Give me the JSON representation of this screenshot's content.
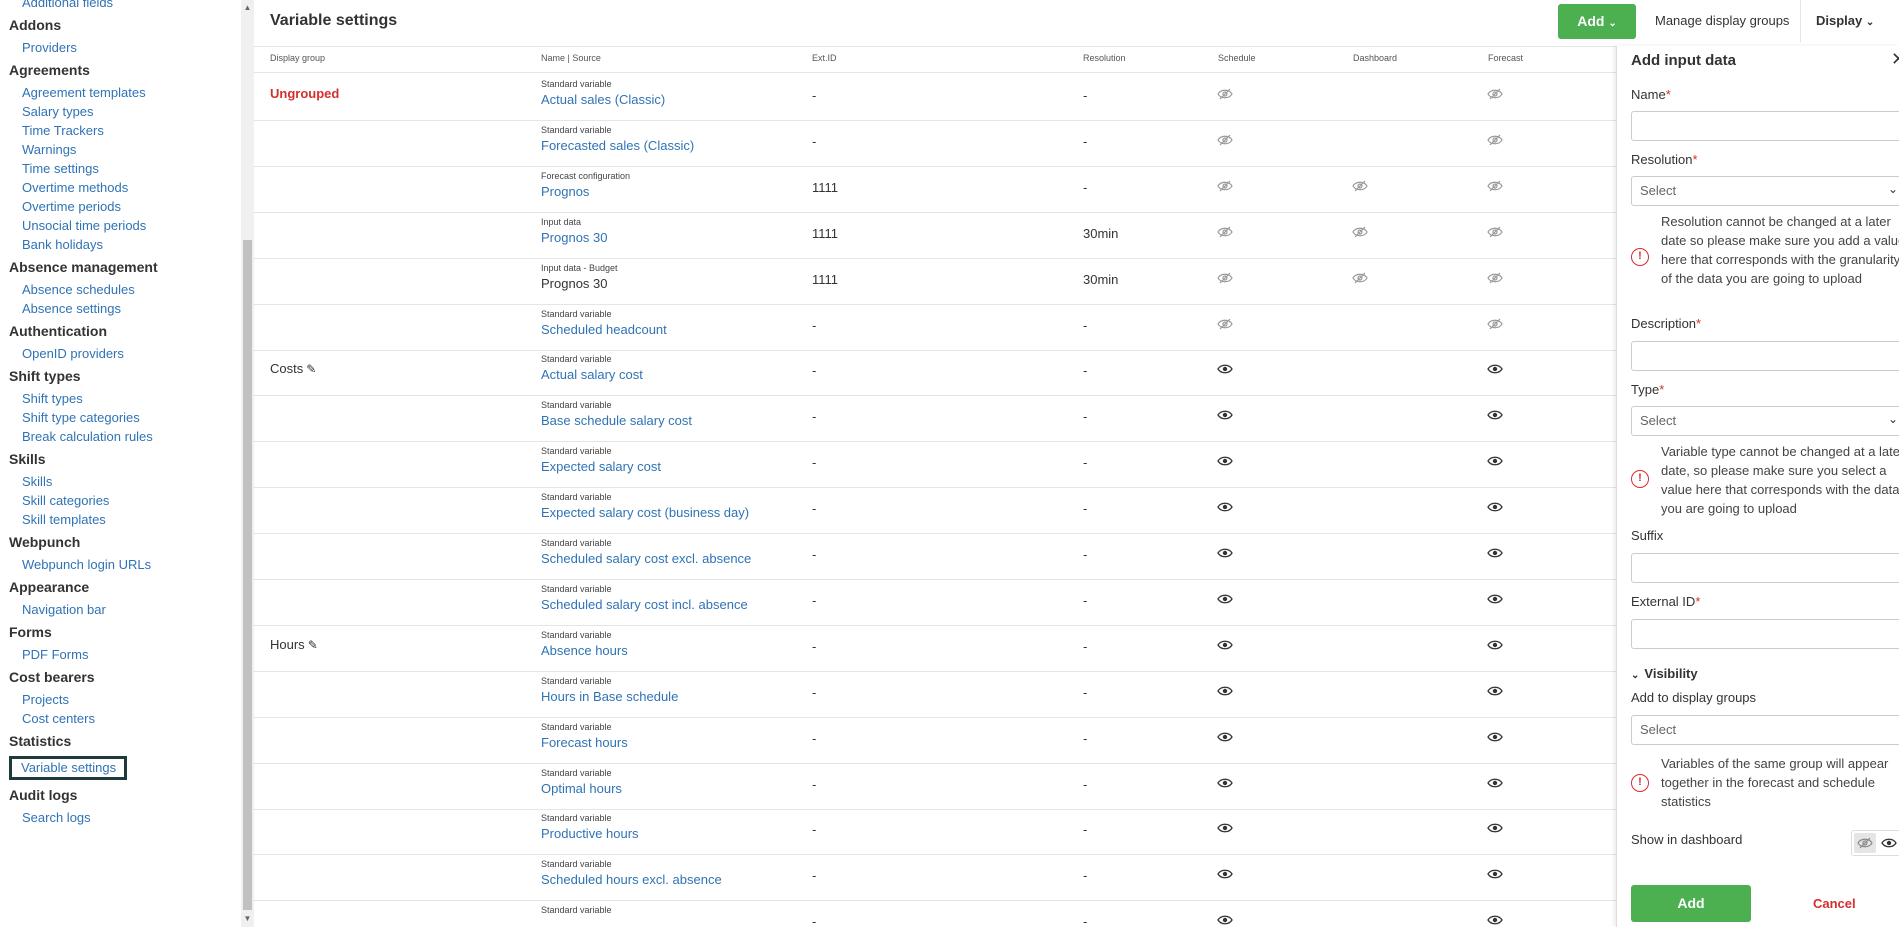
{
  "sidebar": {
    "groups": [
      {
        "title": "",
        "items": [
          "Additional fields"
        ]
      },
      {
        "title": "Addons",
        "items": [
          "Providers"
        ]
      },
      {
        "title": "Agreements",
        "items": [
          "Agreement templates",
          "Salary types",
          "Time Trackers",
          "Warnings",
          "Time settings",
          "Overtime methods",
          "Overtime periods",
          "Unsocial time periods",
          "Bank holidays"
        ]
      },
      {
        "title": "Absence management",
        "items": [
          "Absence schedules",
          "Absence settings"
        ]
      },
      {
        "title": "Authentication",
        "items": [
          "OpenID providers"
        ]
      },
      {
        "title": "Shift types",
        "items": [
          "Shift types",
          "Shift type categories",
          "Break calculation rules"
        ]
      },
      {
        "title": "Skills",
        "items": [
          "Skills",
          "Skill categories",
          "Skill templates"
        ]
      },
      {
        "title": "Webpunch",
        "items": [
          "Webpunch login URLs"
        ]
      },
      {
        "title": "Appearance",
        "items": [
          "Navigation bar"
        ]
      },
      {
        "title": "Forms",
        "items": [
          "PDF Forms"
        ]
      },
      {
        "title": "Cost bearers",
        "items": [
          "Projects",
          "Cost centers"
        ]
      },
      {
        "title": "Statistics",
        "items": [
          "Variable settings"
        ]
      },
      {
        "title": "Audit logs",
        "items": [
          "Search logs"
        ]
      }
    ],
    "active_item": "Variable settings"
  },
  "header": {
    "title": "Variable settings",
    "add_label": "Add",
    "manage_label": "Manage display groups",
    "display_label": "Display"
  },
  "table": {
    "columns": [
      "Display group",
      "Name | Source",
      "Ext.ID",
      "Resolution",
      "Schedule",
      "Dashboard",
      "Forecast"
    ],
    "rows": [
      {
        "group": "Ungrouped",
        "group_style": "red",
        "source": "Standard variable",
        "name": "Actual sales (Classic)",
        "ext_id": "-",
        "resolution": "-",
        "schedule": "hidden",
        "dashboard": "",
        "forecast": "hidden"
      },
      {
        "group": "",
        "source": "Standard variable",
        "name": "Forecasted sales (Classic)",
        "ext_id": "-",
        "resolution": "-",
        "schedule": "hidden",
        "dashboard": "",
        "forecast": "hidden"
      },
      {
        "group": "",
        "source": "Forecast configuration",
        "name": "Prognos",
        "ext_id": "1111",
        "resolution": "-",
        "schedule": "hidden",
        "dashboard": "hidden",
        "forecast": "hidden"
      },
      {
        "group": "",
        "source": "Input data",
        "name": "Prognos 30",
        "ext_id": "1111",
        "resolution": "30min",
        "schedule": "hidden",
        "dashboard": "hidden",
        "forecast": "hidden"
      },
      {
        "group": "",
        "source": "Input data - Budget",
        "name": "Prognos 30",
        "name_style": "black",
        "ext_id": "1111",
        "resolution": "30min",
        "schedule": "hidden",
        "dashboard": "hidden",
        "forecast": "hidden"
      },
      {
        "group": "",
        "source": "Standard variable",
        "name": "Scheduled headcount",
        "ext_id": "-",
        "resolution": "-",
        "schedule": "hidden",
        "dashboard": "",
        "forecast": "hidden"
      },
      {
        "group": "Costs",
        "group_edit": true,
        "source": "Standard variable",
        "name": "Actual salary cost",
        "ext_id": "-",
        "resolution": "-",
        "schedule": "visible",
        "dashboard": "",
        "forecast": "visible"
      },
      {
        "group": "",
        "source": "Standard variable",
        "name": "Base schedule salary cost",
        "ext_id": "-",
        "resolution": "-",
        "schedule": "visible",
        "dashboard": "",
        "forecast": "visible"
      },
      {
        "group": "",
        "source": "Standard variable",
        "name": "Expected salary cost",
        "ext_id": "-",
        "resolution": "-",
        "schedule": "visible",
        "dashboard": "",
        "forecast": "visible"
      },
      {
        "group": "",
        "source": "Standard variable",
        "name": "Expected salary cost (business day)",
        "ext_id": "-",
        "resolution": "-",
        "schedule": "visible",
        "dashboard": "",
        "forecast": "visible"
      },
      {
        "group": "",
        "source": "Standard variable",
        "name": "Scheduled salary cost excl. absence",
        "ext_id": "-",
        "resolution": "-",
        "schedule": "visible",
        "dashboard": "",
        "forecast": "visible"
      },
      {
        "group": "",
        "source": "Standard variable",
        "name": "Scheduled salary cost incl. absence",
        "ext_id": "-",
        "resolution": "-",
        "schedule": "visible",
        "dashboard": "",
        "forecast": "visible"
      },
      {
        "group": "Hours",
        "group_edit": true,
        "source": "Standard variable",
        "name": "Absence hours",
        "ext_id": "-",
        "resolution": "-",
        "schedule": "visible",
        "dashboard": "",
        "forecast": "visible"
      },
      {
        "group": "",
        "source": "Standard variable",
        "name": "Hours in Base schedule",
        "ext_id": "-",
        "resolution": "-",
        "schedule": "visible",
        "dashboard": "",
        "forecast": "visible"
      },
      {
        "group": "",
        "source": "Standard variable",
        "name": "Forecast hours",
        "ext_id": "-",
        "resolution": "-",
        "schedule": "visible",
        "dashboard": "",
        "forecast": "visible"
      },
      {
        "group": "",
        "source": "Standard variable",
        "name": "Optimal hours",
        "ext_id": "-",
        "resolution": "-",
        "schedule": "visible",
        "dashboard": "",
        "forecast": "visible"
      },
      {
        "group": "",
        "source": "Standard variable",
        "name": "Productive hours",
        "ext_id": "-",
        "resolution": "-",
        "schedule": "visible",
        "dashboard": "",
        "forecast": "visible"
      },
      {
        "group": "",
        "source": "Standard variable",
        "name": "Scheduled hours excl. absence",
        "ext_id": "-",
        "resolution": "-",
        "schedule": "visible",
        "dashboard": "",
        "forecast": "visible"
      },
      {
        "group": "",
        "source": "Standard variable",
        "name": "",
        "ext_id": "-",
        "resolution": "-",
        "schedule": "visible",
        "dashboard": "",
        "forecast": "visible"
      }
    ]
  },
  "panel": {
    "title": "Add input data",
    "name_label": "Name",
    "resolution_label": "Resolution",
    "resolution_placeholder": "Select",
    "resolution_info": "Resolution cannot be changed at a later date so please make sure you add a value here that corresponds with the granularity of the data you are going to upload",
    "description_label": "Description",
    "type_label": "Type",
    "type_placeholder": "Select",
    "type_info": "Variable type cannot be changed at a later date, so please make sure you select a value here that corresponds with the data you are going to upload",
    "suffix_label": "Suffix",
    "external_id_label": "External ID",
    "visibility_label": "Visibility",
    "display_groups_label": "Add to display groups",
    "display_groups_placeholder": "Select",
    "display_groups_info": "Variables of the same group will appear together in the forecast and schedule statistics",
    "show_dashboard_label": "Show in dashboard",
    "required_mark": "*",
    "add_label": "Add",
    "cancel_label": "Cancel"
  },
  "colors": {
    "accent_green": "#4caf50",
    "link_blue": "#2f73b5",
    "required_red": "#d32f2f"
  }
}
